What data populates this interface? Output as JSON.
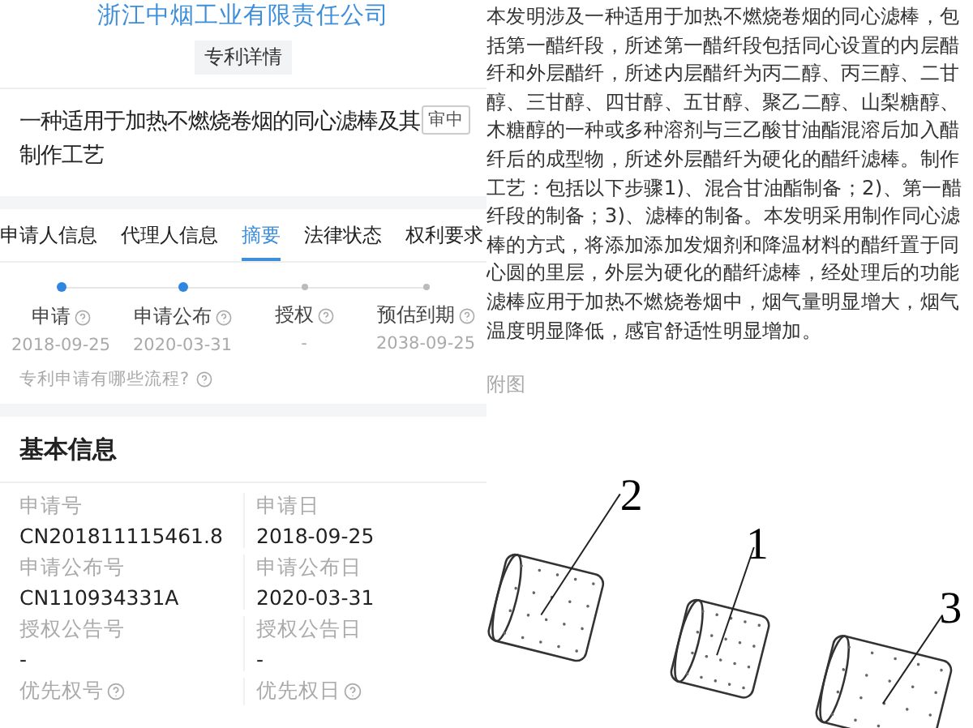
{
  "left": {
    "company": "浙江中烟工业有限责任公司",
    "page_tag": "专利详情",
    "patent": {
      "title": "一种适用于加热不燃烧卷烟的同心滤棒及其制作工艺",
      "status": "审中"
    },
    "tabs": [
      {
        "label": "申请人信息",
        "selected": false
      },
      {
        "label": "代理人信息",
        "selected": false
      },
      {
        "label": "摘要",
        "selected": true
      },
      {
        "label": "法律状态",
        "selected": false
      },
      {
        "label": "权利要求",
        "selected": false
      }
    ],
    "timeline": [
      {
        "label": "申请",
        "date": "2018-09-25",
        "reached": true
      },
      {
        "label": "申请公布",
        "date": "2020-03-31",
        "reached": true
      },
      {
        "label": "授权",
        "date": "-",
        "reached": false
      },
      {
        "label": "预估到期",
        "date": "2038-09-25",
        "reached": false
      }
    ],
    "help_link": "专利申请有哪些流程?",
    "basic_info": {
      "heading": "基本信息",
      "fields": [
        {
          "label": "申请号",
          "value": "CN201811115461.8",
          "help": false
        },
        {
          "label": "申请日",
          "value": "2018-09-25",
          "help": false
        },
        {
          "label": "申请公布号",
          "value": "CN110934331A",
          "help": false
        },
        {
          "label": "申请公布日",
          "value": "2020-03-31",
          "help": false
        },
        {
          "label": "授权公告号",
          "value": "-",
          "help": false
        },
        {
          "label": "授权公告日",
          "value": "-",
          "help": false
        },
        {
          "label": "优先权号",
          "help": true
        },
        {
          "label": "优先权日",
          "help": true
        }
      ]
    }
  },
  "right": {
    "abstract": "本发明涉及一种适用于加热不燃烧卷烟的同心滤棒，包括第一醋纤段，所述第一醋纤段包括同心设置的内层醋纤和外层醋纤，所述内层醋纤为丙二醇、丙三醇、二甘醇、三甘醇、四甘醇、五甘醇、聚乙二醇、山梨糖醇、木糖醇的一种或多种溶剂与三乙酸甘油酯混溶后加入醋纤后的成型物，所述外层醋纤为硬化的醋纤滤棒。制作工艺：包括以下步骤1)、混合甘油酯制备；2)、第一醋纤段的制备；3)、滤棒的制备。本发明采用制作同心滤棒的方式，将添加添加发烟剂和降温材料的醋纤置于同心圆的里层，外层为硬化的醋纤滤棒，经处理后的功能滤棒应用于加热不燃烧卷烟中，烟气量明显增大，烟气温度明显降低，感官舒适性明显增加。",
    "figure": {
      "heading": "附图",
      "labels": [
        "2",
        "1",
        "3"
      ]
    }
  }
}
